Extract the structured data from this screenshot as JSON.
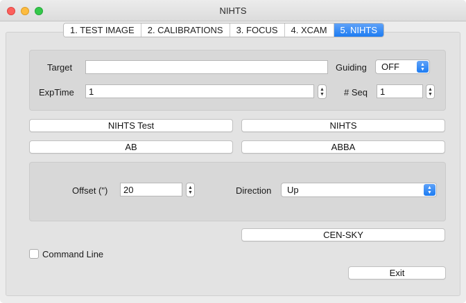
{
  "window": {
    "title": "NIHTS"
  },
  "tabs": [
    {
      "label": "1. TEST IMAGE",
      "active": false
    },
    {
      "label": "2. CALIBRATIONS",
      "active": false
    },
    {
      "label": "3. FOCUS",
      "active": false
    },
    {
      "label": "4. XCAM",
      "active": false
    },
    {
      "label": "5. NIHTS",
      "active": true
    }
  ],
  "exposure": {
    "target_label": "Target",
    "target_value": "",
    "guiding_label": "Guiding",
    "guiding_value": "OFF",
    "exptime_label": "ExpTime",
    "exptime_value": "1",
    "seq_label": "# Seq",
    "seq_value": "1"
  },
  "buttons": {
    "nihts_test": "NIHTS Test",
    "nihts": "NIHTS",
    "ab": "AB",
    "abba": "ABBA",
    "cen_sky": "CEN-SKY",
    "exit": "Exit"
  },
  "offset": {
    "offset_label": "Offset (\")",
    "offset_value": "20",
    "direction_label": "Direction",
    "direction_value": "Up"
  },
  "command_line": {
    "label": "Command Line",
    "checked": false
  },
  "colors": {
    "accent": "#1d7cf2",
    "close": "#fc605c",
    "minimize": "#fdbc40",
    "maximize": "#34c84a"
  }
}
